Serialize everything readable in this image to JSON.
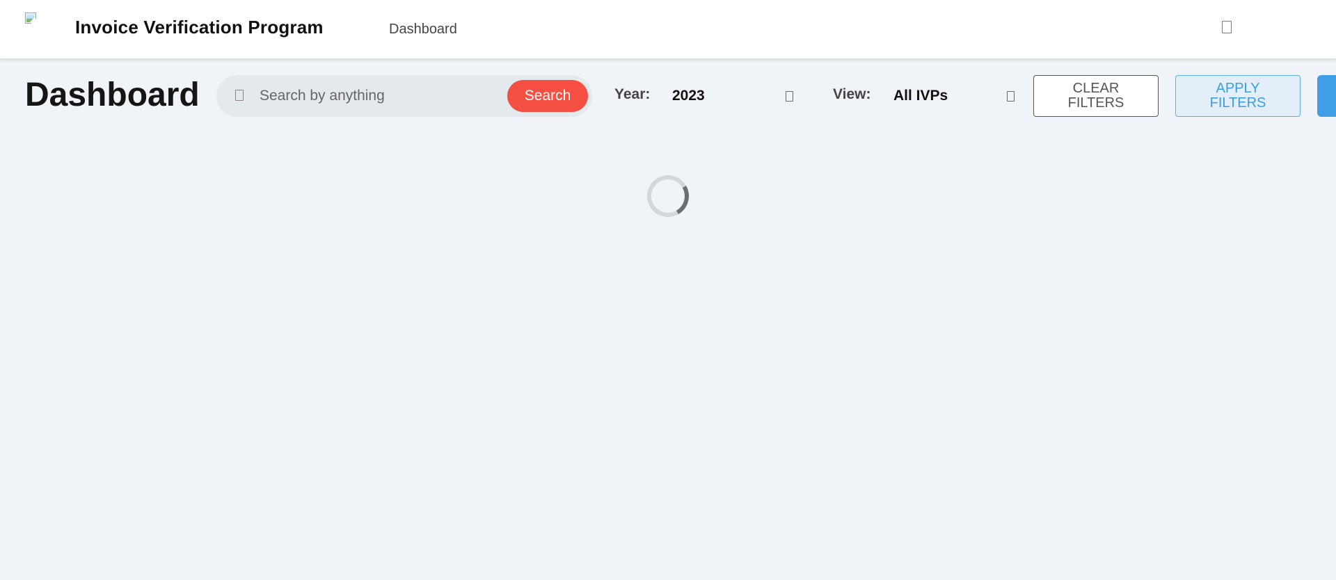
{
  "header": {
    "app_title": "Invoice Verification Program",
    "nav_items": [
      {
        "label": "Dashboard"
      }
    ],
    "logo_icon": "broken-image-icon",
    "right_icon": "user-icon"
  },
  "toolbar": {
    "page_title": "Dashboard",
    "search": {
      "placeholder": "Search by anything",
      "value": "",
      "icon": "search-icon",
      "button_label": "Search"
    },
    "year_filter": {
      "label": "Year:",
      "selected": "2023",
      "icon": "chevron-down-icon"
    },
    "view_filter": {
      "label": "View:",
      "selected": "All IVPs",
      "icon": "chevron-down-icon"
    },
    "clear_filters_label": "CLEAR FILTERS",
    "apply_filters_label": "APPLY FILTERS"
  },
  "main": {
    "loading": true
  },
  "colors": {
    "background": "#f0f4f8",
    "search_button": "#f44f42",
    "apply_accent": "#3a9ee0",
    "apply_background": "#e3eef8",
    "extra_button": "#3f9ee6"
  }
}
